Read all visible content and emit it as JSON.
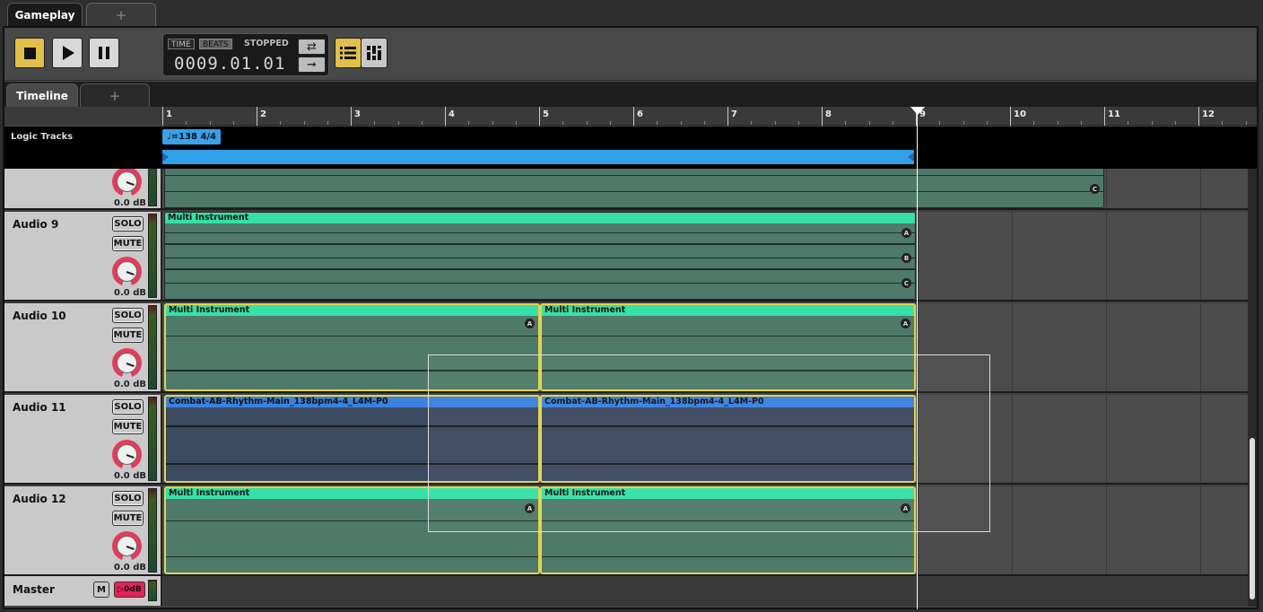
{
  "doc_tabs": {
    "active": "Gameplay",
    "add": "+"
  },
  "transport": {
    "stop_icon": "stop-icon",
    "play_icon": "play-icon",
    "pause_icon": "pause-icon",
    "time_mode": "TIME",
    "beats_mode": "BEATS",
    "status": "STOPPED",
    "position": "0009.01.01",
    "loop_icon": "loop-icon",
    "follow_icon": "arrow-right-icon",
    "list_view_icon": "list-view-icon",
    "mixer_view_icon": "mixer-view-icon"
  },
  "editor_tabs": {
    "active": "Timeline",
    "add": "+"
  },
  "ruler": {
    "bars": [
      "1",
      "2",
      "3",
      "4",
      "5",
      "6",
      "7",
      "8",
      "9",
      "10",
      "11",
      "12"
    ]
  },
  "logic_tracks": {
    "label": "Logic Tracks",
    "tempo": "♩=138 4/4"
  },
  "tracks": [
    {
      "name": "",
      "volume": "0.0 dB",
      "clips": [
        {
          "letter": "C"
        }
      ]
    },
    {
      "name": "Audio 9",
      "solo": "SOLO",
      "mute": "MUTE",
      "volume": "0.0 dB",
      "clips": [
        {
          "title": "Multi Instrument",
          "letters": [
            "A",
            "B",
            "C"
          ]
        }
      ]
    },
    {
      "name": "Audio 10",
      "solo": "SOLO",
      "mute": "MUTE",
      "volume": "0.0 dB",
      "clips": [
        {
          "title": "Multi Instrument",
          "letter": "A"
        },
        {
          "title": "Multi Instrument",
          "letter": "A"
        }
      ]
    },
    {
      "name": "Audio 11",
      "solo": "SOLO",
      "mute": "MUTE",
      "volume": "0.0 dB",
      "clips": [
        {
          "title": "Combat-AB-Rhythm-Main_138bpm4-4_L4M-P0"
        },
        {
          "title": "Combat-AB-Rhythm-Main_138bpm4-4_L4M-P0"
        }
      ]
    },
    {
      "name": "Audio 12",
      "solo": "SOLO",
      "mute": "MUTE",
      "volume": "0.0 dB",
      "clips": [
        {
          "title": "Multi Instrument",
          "letter": "A"
        },
        {
          "title": "Multi Instrument",
          "letter": "A"
        }
      ]
    }
  ],
  "master": {
    "name": "Master",
    "m": "M",
    "volume": "▷0dB"
  },
  "colors": {
    "accent": "#e0c04a",
    "clip_green": "#36e0a8",
    "clip_blue": "#3a82e0",
    "marker": "#31a0e8",
    "selection": "#e2d34a"
  }
}
